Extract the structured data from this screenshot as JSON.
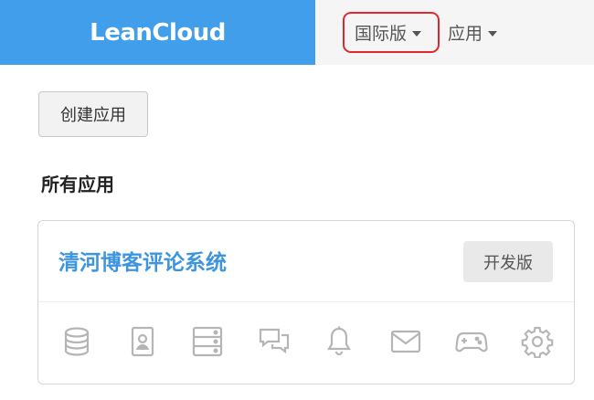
{
  "header": {
    "brand": "LeanCloud",
    "nav": {
      "region_label": "国际版",
      "apps_label": "应用"
    },
    "highlight_color": "#e0282e",
    "brand_color": "#409eea"
  },
  "main": {
    "create_button_label": "创建应用",
    "section_title": "所有应用",
    "app_card": {
      "name": "清河博客评论系统",
      "badge": "开发版",
      "icons": [
        "database-icon",
        "contact-card-icon",
        "server-icon",
        "chat-icon",
        "bell-icon",
        "mail-icon",
        "gamepad-icon",
        "gear-icon"
      ]
    }
  }
}
